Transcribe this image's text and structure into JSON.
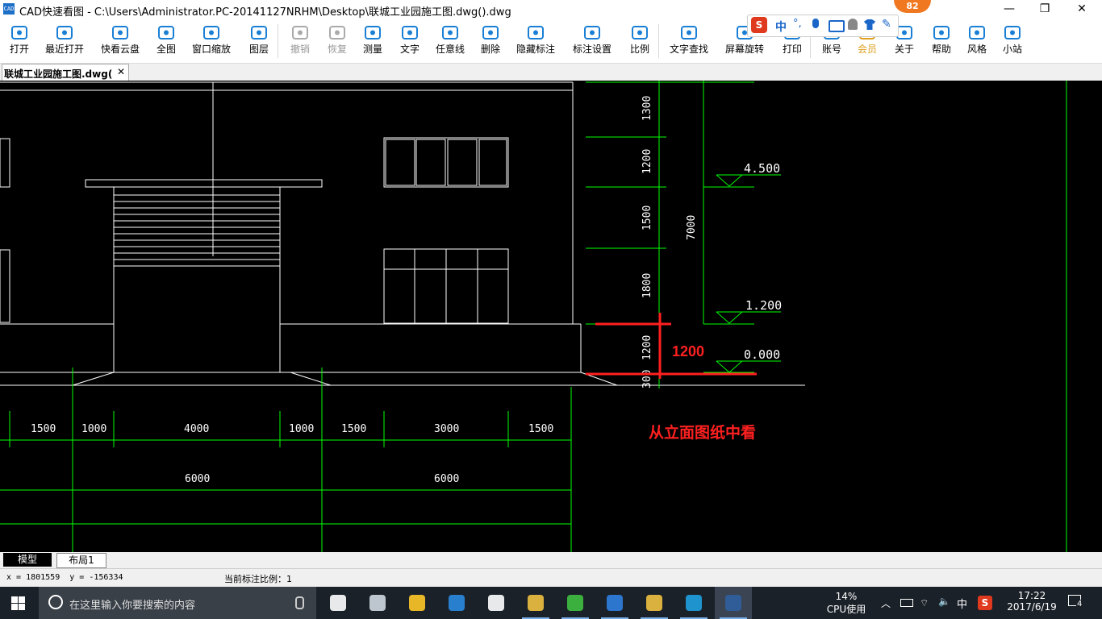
{
  "window": {
    "title": "CAD快速看图 - C:\\Users\\Administrator.PC-20141127NRHM\\Desktop\\联城工业园施工图.dwg().dwg",
    "app_icon_text": "CAD",
    "minimize": "—",
    "restore": "❐",
    "close": "✕"
  },
  "toolbar": [
    {
      "id": "open",
      "label": "打开",
      "icon": "folder-open-icon"
    },
    {
      "id": "recent",
      "label": "最近打开",
      "icon": "history-icon"
    },
    {
      "id": "cloud",
      "label": "快看云盘",
      "icon": "cloud-icon"
    },
    {
      "id": "fullview",
      "label": "全图",
      "icon": "fit-view-icon"
    },
    {
      "id": "zoomwin",
      "label": "窗口缩放",
      "icon": "zoom-window-icon"
    },
    {
      "id": "layers",
      "label": "图层",
      "icon": "layers-icon"
    },
    {
      "id": "undo",
      "label": "撤销",
      "icon": "undo-icon",
      "disabled": true
    },
    {
      "id": "redo",
      "label": "恢复",
      "icon": "redo-icon",
      "disabled": true
    },
    {
      "id": "measure",
      "label": "测量",
      "icon": "ruler-icon"
    },
    {
      "id": "text",
      "label": "文字",
      "icon": "text-icon"
    },
    {
      "id": "freeline",
      "label": "任意线",
      "icon": "pencil-icon"
    },
    {
      "id": "erase",
      "label": "删除",
      "icon": "eraser-icon"
    },
    {
      "id": "hidemark",
      "label": "隐藏标注",
      "icon": "eye-hide-icon"
    },
    {
      "id": "marksettings",
      "label": "标注设置",
      "icon": "settings-icon"
    },
    {
      "id": "scale",
      "label": "比例",
      "icon": "scale-icon"
    },
    {
      "id": "findtext",
      "label": "文字查找",
      "icon": "find-text-icon"
    },
    {
      "id": "rotate",
      "label": "屏幕旋转",
      "icon": "screen-rotate-icon"
    },
    {
      "id": "print",
      "label": "打印",
      "icon": "printer-icon"
    },
    {
      "id": "account",
      "label": "账号",
      "icon": "user-icon"
    },
    {
      "id": "vip",
      "label": "会员",
      "icon": "vip-icon"
    },
    {
      "id": "about",
      "label": "关于",
      "icon": "info-icon"
    },
    {
      "id": "help",
      "label": "帮助",
      "icon": "help-icon"
    },
    {
      "id": "style",
      "label": "风格",
      "icon": "style-icon"
    },
    {
      "id": "site",
      "label": "小站",
      "icon": "k-logo-icon"
    }
  ],
  "ime": {
    "logo": "S",
    "lang": "中",
    "punct": "°,"
  },
  "badge": "82",
  "doc_tab": {
    "title": "联城工业园施工图.dwg().dwg",
    "close": "✕"
  },
  "drawing": {
    "dims_right": [
      "1300",
      "1200",
      "1500",
      "1800",
      "1200",
      "300"
    ],
    "total_height": "7000",
    "elev_marks": [
      "4.500",
      "1.200",
      "0.000"
    ],
    "dims_bottom_1": [
      "1500",
      "1000",
      "4000",
      "1000",
      "1500",
      "3000",
      "1500"
    ],
    "dims_bottom_2": [
      "6000",
      "6000"
    ],
    "annot_value": "1200",
    "annot_note": "从立面图纸中看",
    "colors": {
      "line": "#ffffff",
      "dim": "#00ff00",
      "annot": "#ff2020",
      "bg": "#000000"
    }
  },
  "layout_tabs": [
    "模型",
    "布局1"
  ],
  "status": {
    "coords": "x = 1801559  y = -156334",
    "scale_label": "当前标注比例：1"
  },
  "taskbar": {
    "search_placeholder": "在这里输入你要搜索的内容",
    "apps": [
      "task-view-icon",
      "app-swirl-icon",
      "app-gear-bell-icon",
      "edge-icon",
      "store-icon",
      "explorer-icon",
      "green-app-icon",
      "browser-icon",
      "notes-icon",
      "plus-app-icon",
      "cad-app-icon"
    ],
    "cpu_percent": "14%",
    "cpu_label": "CPU使用",
    "ime": "中",
    "time": "17:22",
    "date": "2017/6/19",
    "notif_count": "4"
  }
}
